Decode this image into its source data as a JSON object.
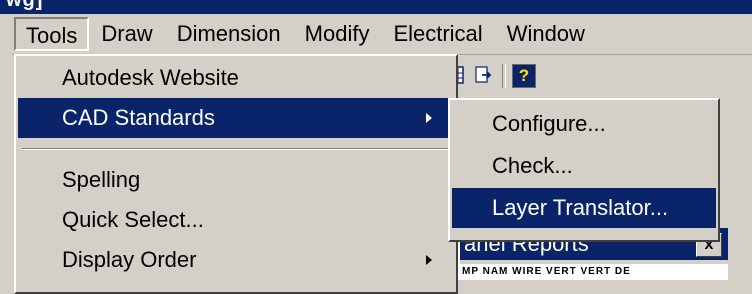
{
  "window": {
    "title": "wg]"
  },
  "menubar": {
    "items": [
      "Tools",
      "Draw",
      "Dimension",
      "Modify",
      "Electrical",
      "Window"
    ],
    "active": "Tools"
  },
  "toolbar": {
    "help_label": "?"
  },
  "tools_menu": {
    "items": [
      {
        "label": "Autodesk Website",
        "submenu": false
      },
      {
        "label": "CAD Standards",
        "submenu": true,
        "selected": true
      },
      {
        "label": "Spelling",
        "submenu": false
      },
      {
        "label": "Quick Select...",
        "submenu": false
      },
      {
        "label": "Display Order",
        "submenu": true
      }
    ]
  },
  "cad_standards_submenu": {
    "items": [
      {
        "label": "Configure..."
      },
      {
        "label": "Check..."
      },
      {
        "label": "Layer Translator...",
        "selected": true
      }
    ]
  },
  "panel": {
    "title": "anel Reports",
    "close_label": "x",
    "columns_text": "MP NAM WIRE VERT VERT DE"
  },
  "colors": {
    "highlight": "#0a246a",
    "face": "#d4d0c8",
    "help_glyph": "#ffe600"
  }
}
